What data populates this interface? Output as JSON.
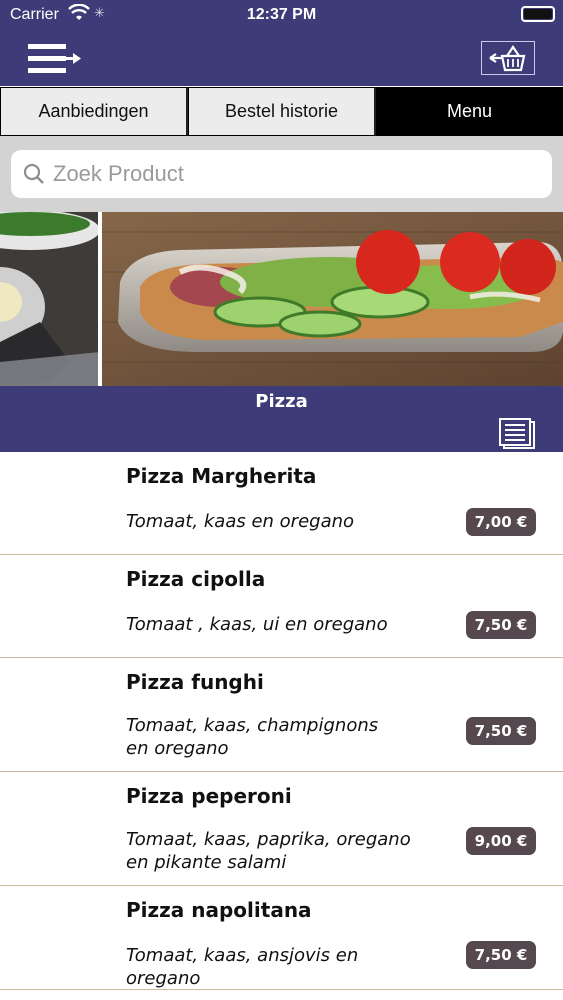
{
  "status_bar": {
    "carrier": "Carrier",
    "time": "12:37 PM"
  },
  "nav": {
    "menu_icon": "menu-arrow-icon",
    "cart_icon": "basket-icon"
  },
  "tabs": [
    {
      "label": "Aanbiedingen",
      "active": false
    },
    {
      "label": "Bestel historie",
      "active": false
    },
    {
      "label": "Menu",
      "active": true
    }
  ],
  "search": {
    "placeholder": "Zoek Product",
    "value": ""
  },
  "category": {
    "title": "Pizza",
    "icon": "list-document-icon"
  },
  "products": [
    {
      "name": "Pizza Margherita",
      "description": "Tomaat, kaas en oregano",
      "price": "7,00 €"
    },
    {
      "name": "Pizza cipolla",
      "description": "Tomaat , kaas, ui en oregano",
      "price": "7,50 €"
    },
    {
      "name": "Pizza funghi",
      "description": "Tomaat, kaas, champignons en oregano",
      "price": "7,50 €"
    },
    {
      "name": "Pizza peperoni",
      "description": "Tomaat, kaas, paprika, oregano en pikante salami",
      "price": "9,00 €"
    },
    {
      "name": "Pizza napolitana",
      "description": "Tomaat, kaas, ansjovis en oregano",
      "price": "7,50 €"
    }
  ],
  "colors": {
    "nav_background": "#3d3b78",
    "price_badge": "#55494f",
    "active_tab": "#000000",
    "inactive_tab": "#ececec"
  }
}
